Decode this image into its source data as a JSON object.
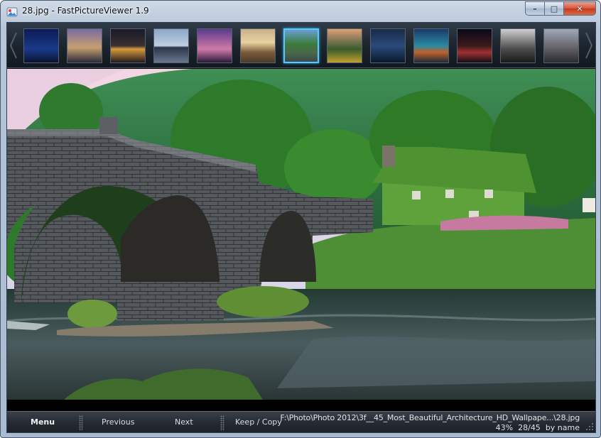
{
  "window": {
    "title": "28.jpg - FastPictureViewer 1.9",
    "controls": {
      "minimize": "–",
      "maximize": "□",
      "close": "✕"
    }
  },
  "thumbnails": {
    "selected_index": 6,
    "items": [
      {
        "icon": "city-night-blue-thumbnail"
      },
      {
        "icon": "skyline-dusk-thumbnail"
      },
      {
        "icon": "harbor-lights-thumbnail"
      },
      {
        "icon": "skyline-reflection-thumbnail"
      },
      {
        "icon": "tower-twilight-thumbnail"
      },
      {
        "icon": "palace-hotel-thumbnail"
      },
      {
        "icon": "bridge-landscape-thumbnail"
      },
      {
        "icon": "city-aerial-green-thumbnail"
      },
      {
        "icon": "city-night-aerial-thumbnail"
      },
      {
        "icon": "suspension-bridge-thumbnail"
      },
      {
        "icon": "city-lights-red-thumbnail"
      },
      {
        "icon": "tall-building-bw-thumbnail"
      },
      {
        "icon": "city-panorama-thumbnail"
      }
    ]
  },
  "toolbar": {
    "menu_label": "Menu",
    "previous_label": "Previous",
    "next_label": "Next",
    "keep_copy_label": "Keep / Copy"
  },
  "status": {
    "file_path": "F:\\Photo\\Photo 2012\\3f__45_Most_Beautiful_Architecture_HD_Wallpape...\\28.jpg",
    "zoom": "43%",
    "position": "28/45",
    "sort": "by name"
  },
  "colors": {
    "selected_thumb_border": "#5cc8ff",
    "strip_bg": "#1b232c",
    "toolbar_bg": "#262c33",
    "status_text": "#dfe3e7"
  }
}
